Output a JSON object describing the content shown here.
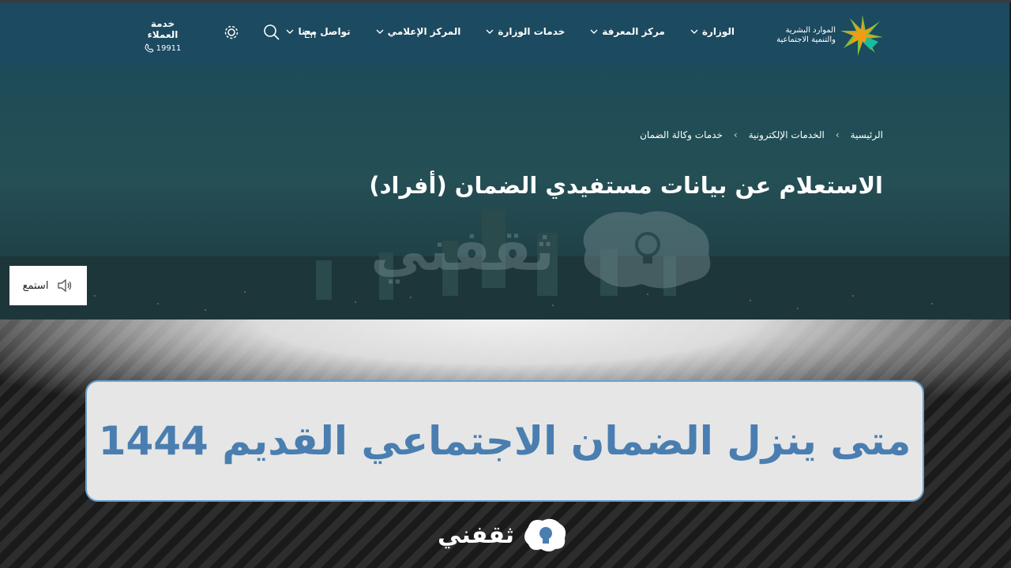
{
  "header": {
    "logo_text_line1": "الموارد البشرية",
    "logo_text_line2": "والتنمية الاجتماعية",
    "nav": [
      {
        "label": "الوزارة"
      },
      {
        "label": "مركز المعرفة"
      },
      {
        "label": "خدمات الوزارة"
      },
      {
        "label": "المركز الإعلامي"
      },
      {
        "label": "تواصل معنا"
      }
    ],
    "lang_label": "En",
    "customer_service_label": "خدمة العملاء",
    "customer_service_number": "19911"
  },
  "hero": {
    "breadcrumb": [
      "الرئيسية",
      "الخدمات الإلكترونية",
      "خدمات وكالة الضمان"
    ],
    "title": "الاستعلام عن بيانات مستفيدي الضمان (أفراد)",
    "watermark": "ثقفني",
    "listen_label": "استمع"
  },
  "card": {
    "title": "متى ينزل الضمان الاجتماعي القديم  1444"
  },
  "footer_logo": "ثقفني",
  "colors": {
    "header_bg": "#1c4a60",
    "card_title": "#4a7eb0",
    "card_border": "#6aa0cf"
  }
}
